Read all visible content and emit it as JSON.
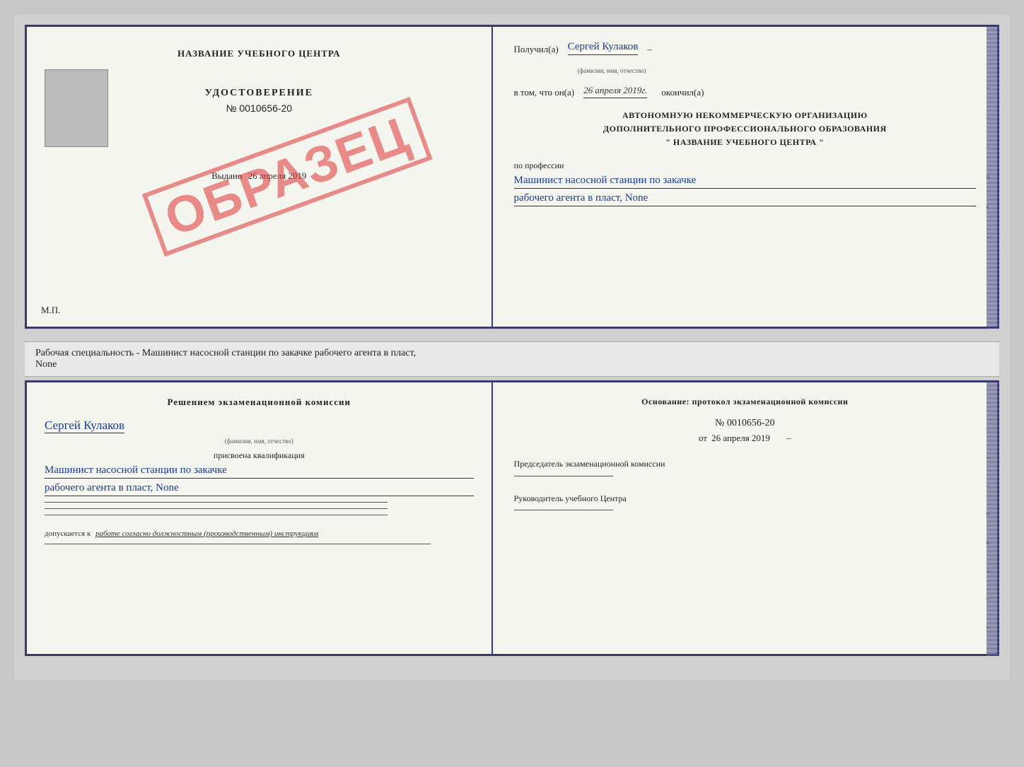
{
  "top_cert": {
    "left": {
      "center_title": "НАЗВАНИЕ УЧЕБНОГО ЦЕНТРА",
      "udostoverenie_label": "УДОСТОВЕРЕНИЕ",
      "number": "№ 0010656-20",
      "vydano_prefix": "Выдано",
      "vydano_date": "26 апреля 2019",
      "mp": "М.П.",
      "stamp_text": "ОБРАЗЕЦ"
    },
    "right": {
      "poluchil_prefix": "Получил(а)",
      "poluchil_name": "Сергей Кулаков",
      "name_hint": "(фамилия, имя, отчество)",
      "vtom_prefix": "в том, что он(а)",
      "vtom_date": "26 апреля 2019г.",
      "okonchil": "окончил(а)",
      "org_line1": "АВТОНОМНУЮ НЕКОММЕРЧЕСКУЮ ОРГАНИЗАЦИЮ",
      "org_line2": "ДОПОЛНИТЕЛЬНОГО ПРОФЕССИОНАЛЬНОГО ОБРАЗОВАНИЯ",
      "org_line3": "\"  НАЗВАНИЕ УЧЕБНОГО ЦЕНТРА  \"",
      "po_professii": "по профессии",
      "profession_line1": "Машинист насосной станции по закачке",
      "profession_line2": "рабочего агента в пласт, None"
    }
  },
  "description": {
    "text": "Рабочая специальность - Машинист насосной станции по закачке рабочего агента в пласт,",
    "text2": "None"
  },
  "bottom_cert": {
    "left": {
      "resheniem": "Решением экзаменационной комиссии",
      "name": "Сергей Кулаков",
      "name_hint": "(фамилия, имя, отчество)",
      "prisvoena": "присвоена квалификация",
      "qual_line1": "Машинист насосной станции по закачке",
      "qual_line2": "рабочего агента в пласт, None",
      "dopuskaetsya": "допускается к",
      "dopuskaetsya_text": "работе согласно должностным (производственным) инструкциям"
    },
    "right": {
      "osnovanie": "Основание: протокол экзаменационной комиссии",
      "protocol_number": "№ 0010656-20",
      "ot_prefix": "от",
      "ot_date": "26 апреля 2019",
      "predsedatel_title": "Председатель экзаменационной комиссии",
      "rukovoditel_title": "Руководитель учебного Центра"
    }
  },
  "side_marks": {
    "items": [
      "-",
      "-",
      "-",
      "и",
      "а",
      "-"
    ]
  }
}
